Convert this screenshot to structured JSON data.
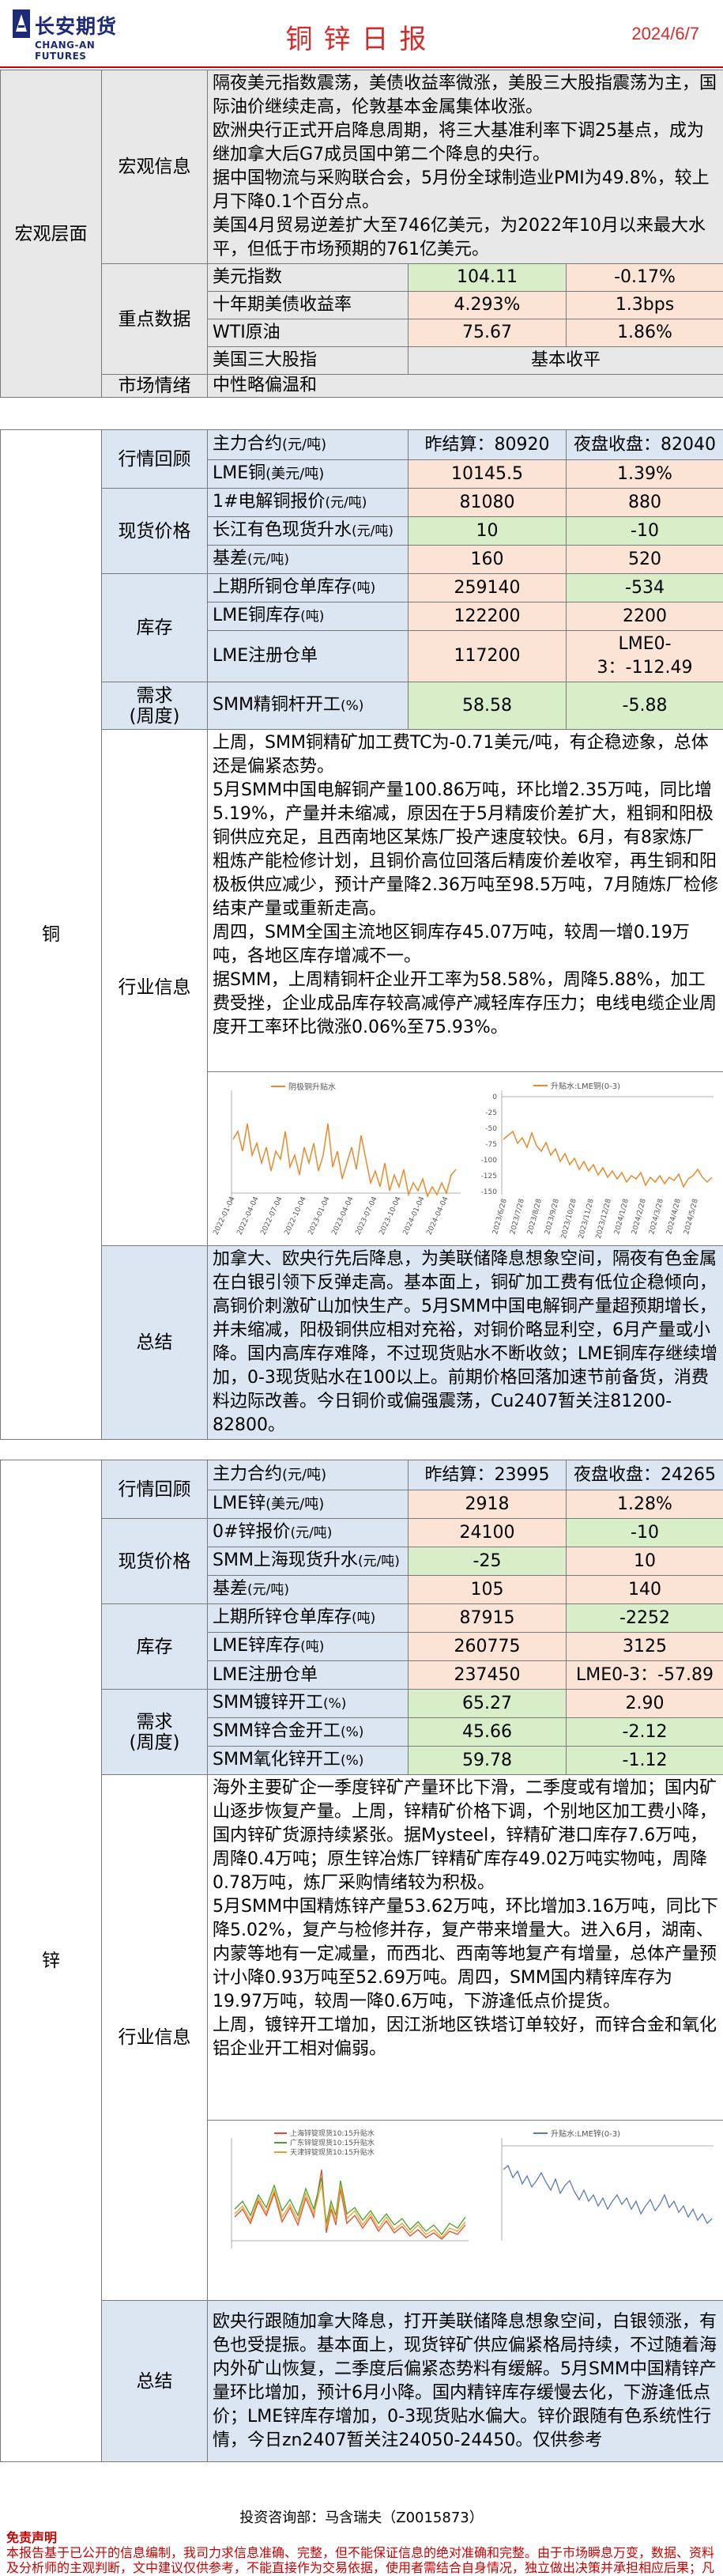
{
  "header": {
    "brand_cn": "长安期货",
    "brand_en": "CHANG-AN FUTURES",
    "title": "铜锌日报",
    "date": "2024/6/7"
  },
  "macro": {
    "section": "宏观层面",
    "info_label": "宏观信息",
    "info_text": [
      "隔夜美元指数震荡，美债收益率微涨，美股三大股指震荡为主，国际油价继续走高，伦敦基本金属集体收涨。",
      "欧洲央行正式开启降息周期，将三大基准利率下调25基点，成为继加拿大后G7成员国中第二个降息的央行。",
      "据中国物流与采购联合会，5月份全球制造业PMI为49.8%，较上月下降0.1个百分点。",
      "美国4月贸易逆差扩大至746亿美元，为2022年10月以来最大水平，但低于市场预期的761亿美元。"
    ],
    "data_label": "重点数据",
    "rows": [
      {
        "name": "美元指数",
        "v1": "104.11",
        "v2": "-0.17%"
      },
      {
        "name": "十年期美债收益率",
        "v1": "4.293%",
        "v2": "1.3bps"
      },
      {
        "name": "WTI原油",
        "v1": "75.67",
        "v2": "1.86%"
      }
    ],
    "equities": {
      "name": "美国三大股指",
      "value": "基本收平"
    },
    "sentiment_label": "市场情绪",
    "sentiment": "中性略偏温和"
  },
  "copper": {
    "section": "铜",
    "market_label": "行情回顾",
    "main": {
      "name": "主力合约",
      "unit": "(元/吨)",
      "settle": "昨结算：80920",
      "night": "夜盘收盘：82040"
    },
    "lme": {
      "name": "LME铜",
      "unit": "(美元/吨)",
      "v1": "10145.5",
      "v2": "1.39%"
    },
    "spot_label": "现货价格",
    "spot": [
      {
        "name": "1#电解铜报价",
        "unit": "(元/吨)",
        "v1": "81080",
        "v2": "880"
      },
      {
        "name": "长江有色现货升水",
        "unit": "(元/吨)",
        "v1": "10",
        "v2": "-10"
      },
      {
        "name": "基差",
        "unit": "(元/吨)",
        "v1": "160",
        "v2": "520"
      }
    ],
    "stock_label": "库存",
    "stock": [
      {
        "name": "上期所铜仓单库存",
        "unit": "(吨)",
        "v1": "259140",
        "v2": "-534"
      },
      {
        "name": "LME铜库存",
        "unit": "(吨)",
        "v1": "122200",
        "v2": "2200"
      },
      {
        "name": "LME注册仓单",
        "unit": "",
        "v1": "117200",
        "v2": "LME0-3：-112.49"
      }
    ],
    "demand_label": "需求\n(周度)",
    "demand": {
      "name": "SMM精铜杆开工",
      "unit": "(%)",
      "v1": "58.58",
      "v2": "-5.88"
    },
    "industry_label": "行业信息",
    "industry_text": [
      "上周，SMM铜精矿加工费TC为-0.71美元/吨，有企稳迹象，总体还是偏紧态势。",
      "5月SMM中国电解铜产量100.86万吨，环比增2.35万吨，同比增5.19%，产量并未缩减，原因在于5月精废价差扩大，粗铜和阳极铜供应充足，且西南地区某炼厂投产速度较快。6月，有8家炼厂粗炼产能检修计划，且铜价高位回落后精废价差收窄，再生铜和阳极板供应减少，预计产量降2.36万吨至98.5万吨，7月随炼厂检修结束产量或重新走高。",
      "周四，SMM全国主流地区铜库存45.07万吨，较周一增0.19万吨，各地区库存增减不一。",
      "据SMM，上周精铜杆企业开工率为58.58%，周降5.88%，加工费受挫，企业成品库存较高减停产减轻库存压力；电线电缆企业周度开工率环比微涨0.06%至75.93%。"
    ],
    "chart1": {
      "legend": "阴极铜升贴水",
      "x_labels": [
        "2022-01-04",
        "2022-04-04",
        "2022-07-04",
        "2022-10-04",
        "2023-01-04",
        "2023-04-04",
        "2023-07-04",
        "2023-10-04",
        "2024-01-04",
        "2024-04-04"
      ]
    },
    "chart2": {
      "legend": "升贴水:LME铜(0-3)",
      "y_ticks": [
        "0",
        "-25",
        "-50",
        "-75",
        "-100",
        "-125",
        "-150"
      ],
      "x_labels": [
        "2023/6/28",
        "2023/7/28",
        "2023/8/28",
        "2023/9/28",
        "2023/10/28",
        "2023/11/28",
        "2023/12/28",
        "2024/1/28",
        "2024/2/28",
        "2024/3/28",
        "2024/4/28",
        "2024/5/28"
      ]
    },
    "summary_label": "总结",
    "summary": "加拿大、欧央行先后降息，为美联储降息想象空间，隔夜有色金属在白银引领下反弹走高。基本面上，铜矿加工费有低位企稳倾向，高铜价刺激矿山加快生产。5月SMM中国电解铜产量超预期增长，并未缩减，阳极铜供应相对充裕，对铜价略显利空，6月产量或小降。国内高库存难降，不过现货贴水不断收敛；LME铜库存继续增加，0-3现货贴水在100以上。前期价格回落加速节前备货，消费料边际改善。今日铜价或偏强震荡，Cu2407暂关注81200-82800。"
  },
  "zinc": {
    "section": "锌",
    "market_label": "行情回顾",
    "main": {
      "name": "主力合约",
      "unit": "(元/吨)",
      "settle": "昨结算：23995",
      "night": "夜盘收盘：24265"
    },
    "lme": {
      "name": "LME锌",
      "unit": "(美元/吨)",
      "v1": "2918",
      "v2": "1.28%"
    },
    "spot_label": "现货价格",
    "spot": [
      {
        "name": "0#锌报价",
        "unit": "(元/吨)",
        "v1": "24100",
        "v2": "-10"
      },
      {
        "name": "SMM上海现货升水",
        "unit": "(元/吨)",
        "v1": "-25",
        "v2": "10"
      },
      {
        "name": "基差",
        "unit": "(元/吨)",
        "v1": "105",
        "v2": "140"
      }
    ],
    "stock_label": "库存",
    "stock": [
      {
        "name": "上期所锌仓单库存",
        "unit": "(吨)",
        "v1": "87915",
        "v2": "-2252"
      },
      {
        "name": "LME锌库存",
        "unit": "(吨)",
        "v1": "260775",
        "v2": "3125"
      },
      {
        "name": "LME注册仓单",
        "unit": "",
        "v1": "237450",
        "v2": "LME0-3：-57.89"
      }
    ],
    "demand_label": "需求\n(周度)",
    "demand": [
      {
        "name": "SMM镀锌开工",
        "unit": "(%)",
        "v1": "65.27",
        "v2": "2.90"
      },
      {
        "name": "SMM锌合金开工",
        "unit": "(%)",
        "v1": "45.66",
        "v2": "-2.12"
      },
      {
        "name": "SMM氧化锌开工",
        "unit": "(%)",
        "v1": "59.78",
        "v2": "-1.12"
      }
    ],
    "industry_label": "行业信息",
    "industry_text": [
      "海外主要矿企一季度锌矿产量环比下滑，二季度或有增加；国内矿山逐步恢复产量。上周，锌精矿价格下调，个别地区加工费小降，国内锌矿货源持续紧张。据Mysteel，锌精矿港口库存7.6万吨，周降0.4万吨；原生锌冶炼厂锌精矿库存49.02万吨实物吨，周降0.78万吨，炼厂采购情绪较为积极。",
      "5月SMM中国精炼锌产量53.62万吨，环比增加3.16万吨，同比下降5.02%，复产与检修并存，复产带来增量大。进入6月，湖南、内蒙等地有一定减量，而西北、西南等地复产有增量，总体产量预计小降0.93万吨至52.69万吨。周四，SMM国内精锌库存为19.97万吨，较周一降0.6万吨，下游逢低点价提货。",
      "上周，镀锌开工增加，因江浙地区铁塔订单较好，而锌合金和氧化铝企业开工相对偏弱。"
    ],
    "chart1": {
      "legend": [
        "上海锌锭现货10:15升贴水",
        "广东锌锭现货10:15升贴水",
        "天津锌锭现货10:15升贴水"
      ]
    },
    "chart2": {
      "legend": "升贴水:LME锌(0-3)"
    },
    "summary_label": "总结",
    "summary": "欧央行跟随加拿大降息，打开美联储降息想象空间，白银领涨，有色也受提振。基本面上，现货锌矿供应偏紧格局持续，不过随着海内外矿山恢复，二季度后偏紧态势料有缓解。5月SMM中国精锌产量环比增加，预计6月小降。国内精锌库存缓慢去化，下游逢低点价；LME锌库存增加，0-3现货贴水偏大。锌价跟随有色系统性行情，今日zn2407暂关注24050-24450。仅供参考"
  },
  "footer": {
    "analyst": "投资咨询部：马含瑞夫（Z0015873）",
    "disclaimer_title": "免责声明",
    "disclaimer": "本报告基于已公开的信息编制，我司力求信息准确、完整，但不能保证信息的绝对准确和完整。由于市场瞬息万变，数据、资料及分析师的主观判断，文中建议仅供参考，不能直接作为交易依据，使用者需结合自身情况，独立做出决策并承担相应后果；凡据本报告入市者，本公司及作者均不承担任何法律责任。"
  }
}
